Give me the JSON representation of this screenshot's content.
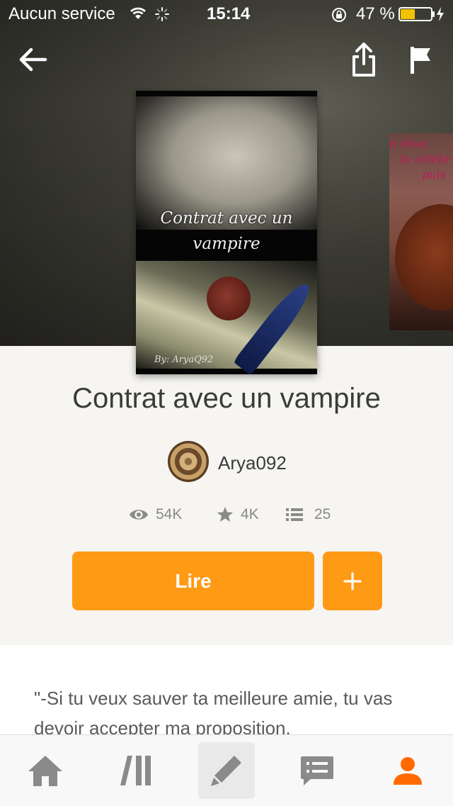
{
  "status_bar": {
    "carrier": "Aucun service",
    "time": "15:14",
    "battery": "47 %"
  },
  "story": {
    "title": "Contrat avec un vampire",
    "cover_title": "Contrat avec un vampire",
    "cover_author": "By: AryaQ92",
    "next_cover_text": [
      "n rêve,",
      "la célébr",
      "puis"
    ],
    "author": "Arya092",
    "reads": "54K",
    "votes": "4K",
    "parts": "25",
    "description": "\"-Si tu veux sauver ta meilleure amie, tu vas devoir accepter ma proposition."
  },
  "actions": {
    "read_label": "Lire",
    "add_label": "+"
  },
  "colors": {
    "accent": "#ff9a15",
    "active_tab": "#ff6a00"
  },
  "icons": {
    "back": "arrow-left-icon",
    "share": "share-icon",
    "report": "flag-icon",
    "reads": "eye-icon",
    "votes": "star-icon",
    "parts": "list-icon",
    "tabs": [
      "home-icon",
      "library-icon",
      "pencil-icon",
      "messages-icon",
      "profile-icon"
    ]
  }
}
